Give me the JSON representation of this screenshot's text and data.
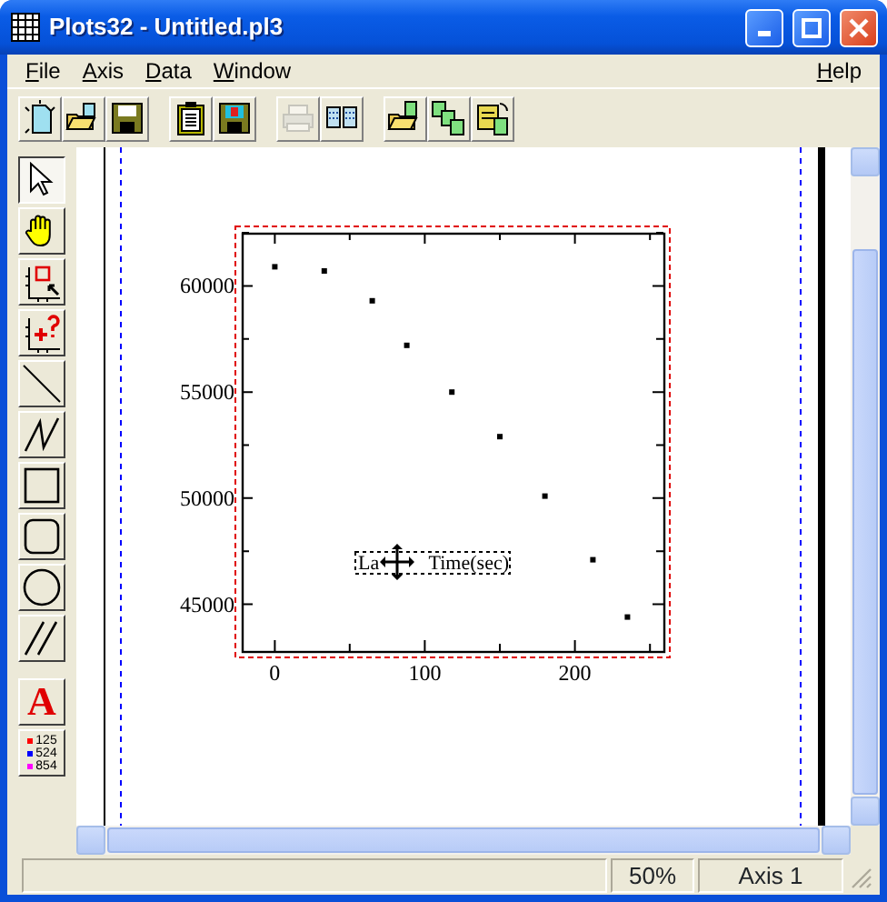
{
  "window": {
    "title": "Plots32 - Untitled.pl3"
  },
  "menu": [
    {
      "label": "File"
    },
    {
      "label": "Axis"
    },
    {
      "label": "Data"
    },
    {
      "label": "Window"
    }
  ],
  "help_menu": {
    "label": "Help"
  },
  "toolbar_groups": [
    {
      "buttons": [
        {
          "kind": "new",
          "disabled": false
        },
        {
          "kind": "open",
          "disabled": false
        },
        {
          "kind": "save",
          "disabled": false
        }
      ]
    },
    {
      "buttons": [
        {
          "kind": "clipboard",
          "disabled": false
        },
        {
          "kind": "export",
          "disabled": false
        }
      ]
    },
    {
      "buttons": [
        {
          "kind": "print",
          "disabled": true
        },
        {
          "kind": "layout",
          "disabled": false
        }
      ]
    },
    {
      "buttons": [
        {
          "kind": "open_data",
          "disabled": false
        },
        {
          "kind": "copy_data",
          "disabled": false
        },
        {
          "kind": "paste_data",
          "disabled": false
        }
      ]
    }
  ],
  "tool_groups": [
    {
      "tools": [
        {
          "kind": "pointer",
          "selected": true
        },
        {
          "kind": "hand",
          "selected": false
        },
        {
          "kind": "select_axis",
          "selected": false
        },
        {
          "kind": "add_point",
          "selected": false
        },
        {
          "kind": "line",
          "selected": false
        },
        {
          "kind": "polyline",
          "selected": false
        },
        {
          "kind": "rectangle",
          "selected": false
        },
        {
          "kind": "rounded_rectangle",
          "selected": false
        },
        {
          "kind": "ellipse",
          "selected": false
        },
        {
          "kind": "parallel_lines",
          "selected": false
        }
      ]
    },
    {
      "tools": [
        {
          "kind": "text",
          "glyph": "A",
          "selected": false
        },
        {
          "kind": "legend",
          "selected": false,
          "lines": [
            {
              "text": "125",
              "color": "#ff0000"
            },
            {
              "text": "524",
              "color": "#0000ff"
            },
            {
              "text": "854",
              "color": "#ff00ff"
            }
          ]
        }
      ]
    }
  ],
  "document": {
    "selected": true,
    "axis_label": {
      "parts": [
        "La",
        "Time(sec)"
      ]
    },
    "chart_data": {
      "type": "scatter",
      "x": [
        0,
        33,
        65,
        88,
        118,
        150,
        180,
        212,
        235
      ],
      "series": [
        {
          "color": "#000000",
          "values": [
            60900,
            60700,
            59300,
            57200,
            55000,
            52900,
            50100,
            47100,
            44400
          ]
        }
      ],
      "xlim": [
        -22,
        259
      ],
      "ylim": [
        42800,
        62500
      ],
      "xticks": [
        0,
        100,
        200
      ],
      "yticks": [
        45000,
        50000,
        55000,
        60000
      ]
    }
  },
  "status_bar": {
    "zoom": "50%",
    "axis": "Axis 1"
  }
}
